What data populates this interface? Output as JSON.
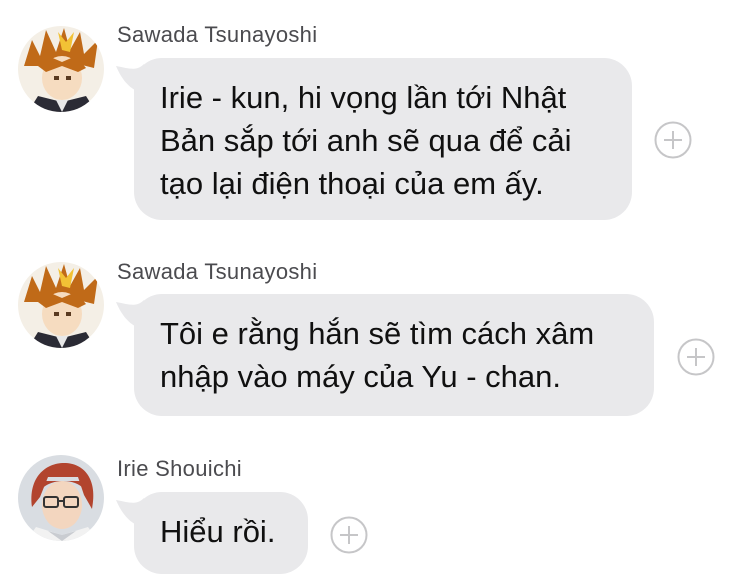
{
  "messages": [
    {
      "sender": "Sawada Tsunayoshi",
      "avatar_icon": "spiky-hair-avatar-icon",
      "text": "Irie - kun, hi vọng lần tới Nhật Bản sắp tới anh sẽ qua để cải tạo lại điện thoại của em ấy."
    },
    {
      "sender": "Sawada Tsunayoshi",
      "avatar_icon": "spiky-hair-avatar-icon",
      "text": "Tôi e rằng hắn sẽ tìm cách xâm nhập vào máy của Yu - chan."
    },
    {
      "sender": "Irie Shouichi",
      "avatar_icon": "red-hair-glasses-avatar-icon",
      "text": "Hiểu rồi."
    }
  ],
  "colors": {
    "bubble": "#e9e9eb",
    "sender_text": "#4b4b4f",
    "message_text": "#101010",
    "plus_icon": "#c6c6c8"
  },
  "icons": {
    "add_reaction": "plus-circle-icon"
  }
}
